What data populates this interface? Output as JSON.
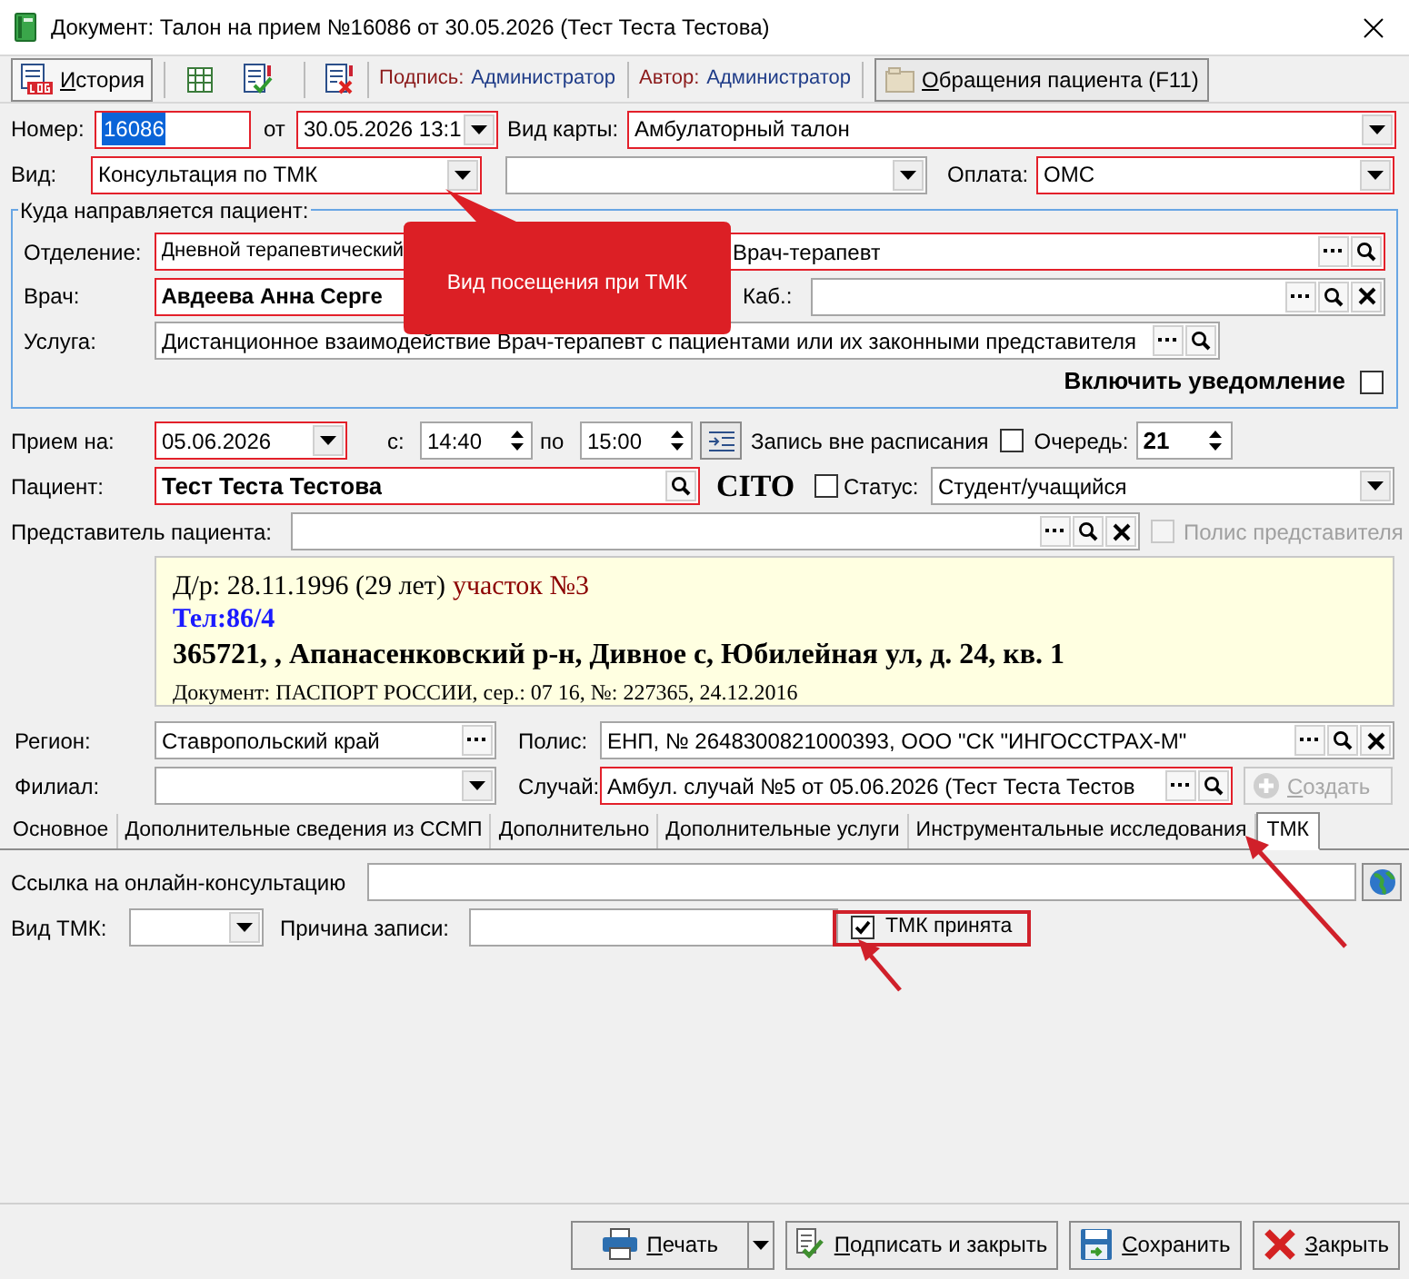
{
  "window": {
    "title": "Документ: Талон на прием №16086 от 30.05.2026 (Тест Теста Тестова)"
  },
  "toolbar": {
    "history_button": "История",
    "signature_label": "Подпись:",
    "signature_value": "Администратор",
    "author_label": "Автор:",
    "author_value": "Администратор",
    "appeals_button": "Обращения пациента (F11)"
  },
  "header": {
    "number": {
      "label": "Номер:",
      "value": "16086",
      "highlighted": true,
      "value_selected": true
    },
    "date": {
      "label": "от",
      "value": "30.05.2026 13:1",
      "highlighted": true
    },
    "card_type": {
      "label": "Вид карты:",
      "value": "Амбулаторный талон",
      "highlighted": true
    },
    "visit_kind": {
      "label": "Вид:",
      "value": "Консультация по ТМК",
      "highlighted": true
    },
    "visit_subkind": {
      "highlighted": false
    },
    "payment": {
      "label": "Оплата:",
      "value": "ОМС",
      "highlighted": true
    }
  },
  "referral": {
    "title": "Куда направляется пациент:",
    "department": {
      "label": "Отделение:",
      "value": "Дневной терапевтический",
      "highlighted": true
    },
    "position": {
      "value": "Врач-терапевт",
      "highlighted": true
    },
    "doctor": {
      "label": "Врач:",
      "value": "Авдеева Анна Серге",
      "highlighted": true
    },
    "room": {
      "label": "Каб.:",
      "highlighted": false
    },
    "service": {
      "label": "Услуга:",
      "value": "Дистанционное взаимодействие Врач-терапевт с пациентами или их законными представителя",
      "highlighted": false
    },
    "notify": {
      "label": "Включить уведомление",
      "checked": false
    }
  },
  "tooltip": {
    "text": "Вид посещения при ТМК"
  },
  "appointment": {
    "date": {
      "label": "Прием на:",
      "value": "05.06.2026",
      "highlighted": true
    },
    "from": {
      "label": "с:",
      "value": "14:40"
    },
    "to": {
      "label": "по",
      "value": "15:00"
    },
    "off_schedule": {
      "label": "Запись вне расписания",
      "checked": false
    },
    "queue": {
      "label": "Очередь:",
      "value": "21"
    },
    "patient": {
      "label": "Пациент:",
      "value": "Тест Теста Тестова",
      "highlighted": true
    },
    "cito": "CITO",
    "status": {
      "label": "Статус:",
      "checked": false,
      "value": "Студент/учащийся"
    },
    "representative": {
      "label": "Представитель пациента:"
    },
    "representative_policy": {
      "label": "Полис представителя",
      "checked": false,
      "disabled": true
    }
  },
  "patient_info": [
    {
      "kind": "birth",
      "text": "Д/р: 28.11.1996 (29 лет)",
      "district": "участок №3"
    },
    {
      "kind": "phone",
      "text": "Тел:86/4"
    },
    {
      "kind": "address",
      "text": "365721, , Апанасенковский р-н, Дивное с, Юбилейная ул, д. 24, кв. 1"
    },
    {
      "kind": "document",
      "text": "Документ: ПАСПОРТ РОССИИ, сер.: 07 16, №: 227365, 24.12.2016"
    }
  ],
  "insurance": {
    "region": {
      "label": "Регион:",
      "value": "Ставропольский край"
    },
    "policy": {
      "label": "Полис:",
      "value": "ЕНП, № 2648300821000393, ООО \"СК \"ИНГОССТРАХ-М\""
    },
    "branch": {
      "label": "Филиал:"
    },
    "case": {
      "label": "Случай:",
      "value": "Амбул. случай №5 от 05.06.2026 (Тест Теста Тестов",
      "highlighted": true
    },
    "create_button": {
      "label": "Создать",
      "disabled": true
    }
  },
  "tabs": [
    {
      "label": "Основное",
      "selected": false
    },
    {
      "label": "Дополнительные сведения из ССМП",
      "selected": false
    },
    {
      "label": "Дополнительно",
      "selected": false
    },
    {
      "label": "Дополнительные услуги",
      "selected": false
    },
    {
      "label": "Инструментальные исследования",
      "selected": false
    },
    {
      "label": "ТМК",
      "selected": true
    }
  ],
  "tmk": {
    "link_label": "Ссылка на онлайн-консультацию",
    "type_label": "Вид ТМК:",
    "reason_label": "Причина записи:",
    "accepted": {
      "label": "ТМК принята",
      "checked": true
    }
  },
  "buttons": {
    "print": "Печать",
    "sign": "Подписать и закрыть",
    "save": "Сохранить",
    "close": "Закрыть"
  }
}
